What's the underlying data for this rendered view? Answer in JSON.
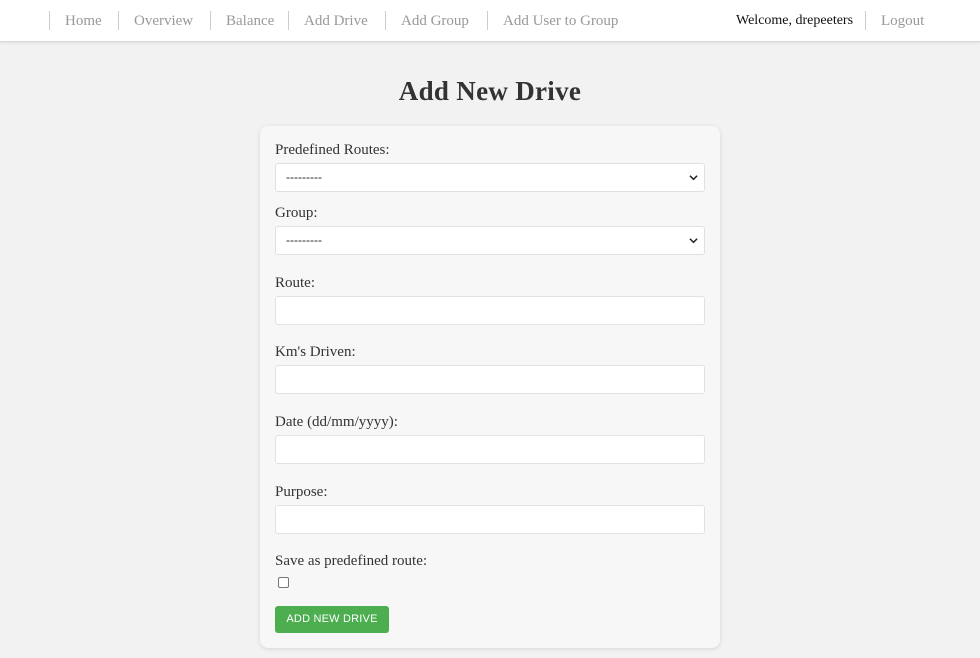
{
  "nav": {
    "items": [
      {
        "label": "Home"
      },
      {
        "label": "Overview"
      },
      {
        "label": "Balance"
      },
      {
        "label": "Add Drive"
      },
      {
        "label": "Add Group"
      },
      {
        "label": "Add User to Group"
      }
    ],
    "welcome": "Welcome, drepeeters",
    "logout": "Logout"
  },
  "page": {
    "title": "Add New Drive"
  },
  "form": {
    "predefined_routes": {
      "label": "Predefined Routes:",
      "selected": "---------"
    },
    "group": {
      "label": "Group:",
      "selected": "---------"
    },
    "route": {
      "label": "Route:",
      "value": ""
    },
    "kms": {
      "label": "Km's Driven:",
      "value": ""
    },
    "date": {
      "label": "Date (dd/mm/yyyy):",
      "value": ""
    },
    "purpose": {
      "label": "Purpose:",
      "value": ""
    },
    "save_route": {
      "label": "Save as predefined route:",
      "checked": false
    },
    "submit_label": "ADD NEW DRIVE"
  },
  "colors": {
    "accent": "#4cae4f",
    "background": "#f2f2f2",
    "card": "#f7f7f7",
    "nav_text": "#999999"
  }
}
